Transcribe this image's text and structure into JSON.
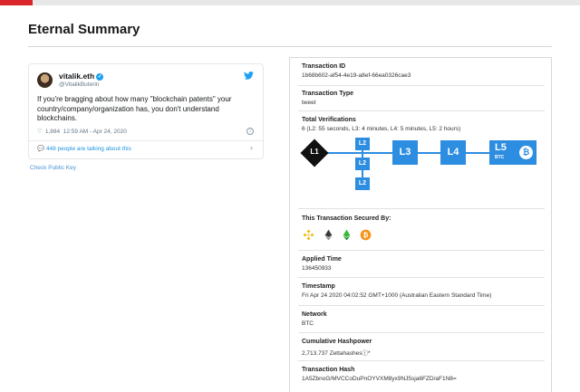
{
  "page": {
    "title": "Eternal Summary"
  },
  "tweet": {
    "name": "vitalik.eth",
    "handle": "@VitalikButerin",
    "text": "If you're bragging about how many \"blockchain patents\" your country/company/organization has, you don't understand blockchains.",
    "likes": "1,884",
    "timestamp": "12:59 AM - Apr 24, 2020",
    "talking": "448 people are talking about this"
  },
  "check_public_key": "Check Public Key",
  "summary": {
    "transaction_id": {
      "label": "Transaction ID",
      "value": "1b68b602-af54-4e19-a8ef-66ea0326cae3"
    },
    "transaction_type": {
      "label": "Transaction Type",
      "value": "tweet"
    },
    "total_verifications": {
      "label": "Total Verifications",
      "value": "6 (L2: 55 seconds, L3: 4 minutes, L4: 5 minutes, L5: 2 hours)"
    },
    "levels": {
      "l1": "L1",
      "l2": "L2",
      "l3": "L3",
      "l4": "L4",
      "l5": "L5",
      "l5_sub": "BTC"
    },
    "secured_by": {
      "label": "This Transaction Secured By:",
      "icons": [
        "binance-icon",
        "ethereum-icon",
        "ethereum-classic-icon",
        "bitcoin-icon"
      ]
    },
    "applied_time": {
      "label": "Applied Time",
      "value": "136450933"
    },
    "timestamp": {
      "label": "Timestamp",
      "value": "Fri Apr 24 2020 04:02:52 GMT+1000 (Australian Eastern Standard Time)"
    },
    "network": {
      "label": "Network",
      "value": "BTC"
    },
    "cumulative_hashpower": {
      "label": "Cumulative Hashpower",
      "value": "2,713.737 Zettahashesⓘ*"
    },
    "transaction_hash": {
      "label": "Transaction Hash",
      "value": "1A5ZbnoG/MVCCoDuPnOYVXM8yx9NJ5sja6FZD/aF1N8="
    }
  },
  "colors": {
    "accent": "#2d8de0",
    "brand_red": "#d9262b",
    "twitter_blue": "#1da1f2"
  }
}
